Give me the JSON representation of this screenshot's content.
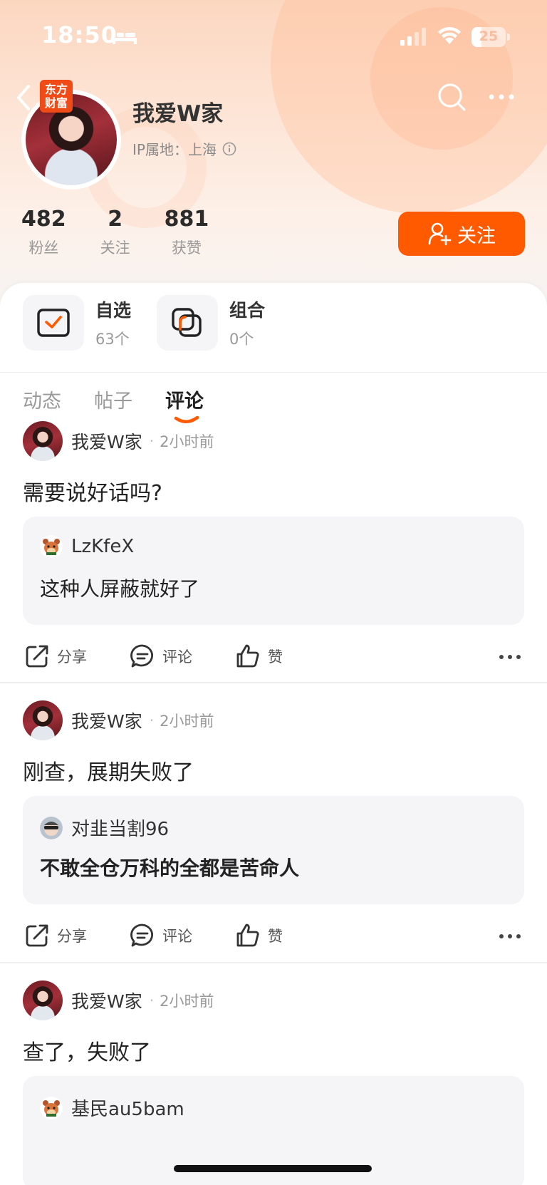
{
  "status_bar": {
    "time": "18:50",
    "battery": "25"
  },
  "profile": {
    "brand_badge": "东方财富",
    "name": "我爱W家",
    "ip_location": "IP属地：上海",
    "stats": [
      {
        "value": "482",
        "label": "粉丝"
      },
      {
        "value": "2",
        "label": "关注"
      },
      {
        "value": "881",
        "label": "获赞"
      }
    ],
    "follow_label": "关注"
  },
  "shortcuts": [
    {
      "title": "自选",
      "count": "63个",
      "icon": "watchlist-check-icon"
    },
    {
      "title": "组合",
      "count": "0个",
      "icon": "portfolio-squares-icon"
    }
  ],
  "tabs": [
    {
      "label": "动态",
      "active": false
    },
    {
      "label": "帖子",
      "active": false
    },
    {
      "label": "评论",
      "active": true
    }
  ],
  "posts": [
    {
      "author": "我爱W家",
      "time": "2小时前",
      "text": "需要说好话吗?",
      "quote_user": "LzKfeX",
      "quote_text": "这种人屏蔽就好了"
    },
    {
      "author": "我爱W家",
      "time": "2小时前",
      "text": "刚查，展期失败了",
      "quote_user": "对韭当割96",
      "quote_text": "不敢全仓万科的全都是苦命人"
    },
    {
      "author": "我爱W家",
      "time": "2小时前",
      "text": "查了，失败了",
      "quote_user": "基民au5bam",
      "quote_text": ""
    }
  ],
  "actions": {
    "share": "分享",
    "comment": "评论",
    "like": "赞"
  },
  "colors": {
    "accent": "#ff5a00",
    "brand_badge": "#f04a16"
  }
}
